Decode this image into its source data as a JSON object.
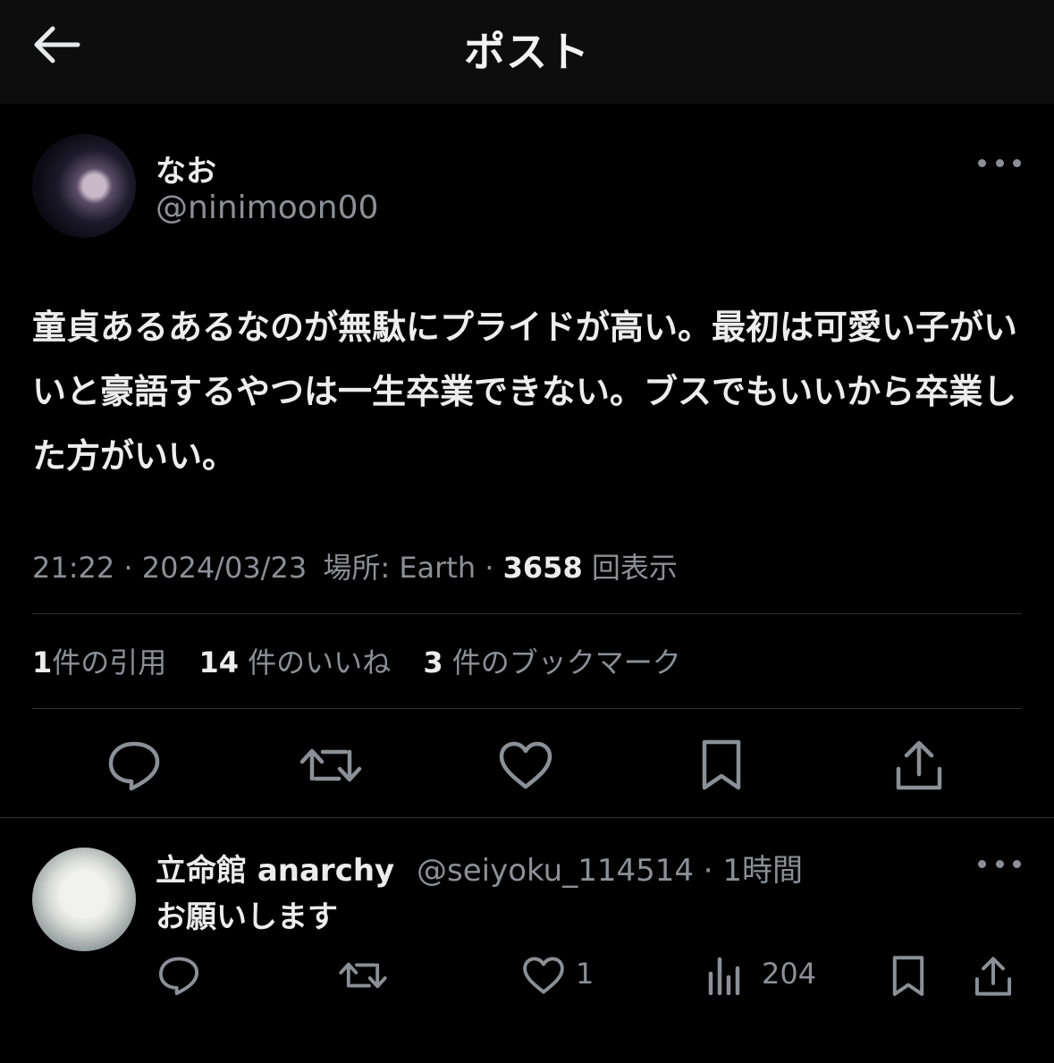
{
  "header": {
    "title": "ポスト",
    "back_icon": "arrow-left-icon"
  },
  "tweet": {
    "author_name": "なお",
    "author_handle": "@ninimoon00",
    "text": "童貞あるあるなのが無駄にプライドが高い。最初は可愛い子がいいと豪語するやつは一生卒業できない。ブスでもいいから卒業した方がいい。",
    "time": "21:22",
    "sep1": "·",
    "date": "2024/03/23",
    "location_label": "場所:",
    "location": "Earth",
    "sep2": "·",
    "views_count": "3658",
    "views_label": "回表示"
  },
  "stats": {
    "quotes_count": "1",
    "quotes_label": "件の引用",
    "likes_count": "14",
    "likes_label": "件のいいね",
    "bookmarks_count": "3",
    "bookmarks_label": "件のブックマーク"
  },
  "actions": [
    "reply-icon",
    "retweet-icon",
    "like-icon",
    "bookmark-icon",
    "share-icon"
  ],
  "reply": {
    "author_name": "立命館 anarchy",
    "author_handle": "@seiyoku_114514",
    "sep": "·",
    "time_ago": "1時間",
    "text": "お願いします",
    "likes": "1",
    "views": "204"
  },
  "colors": {
    "background": "#000000",
    "header_bg": "#0d0d0d",
    "primary_text": "#e7e9ea",
    "secondary_text": "#8b9096",
    "divider": "#2f3336"
  }
}
